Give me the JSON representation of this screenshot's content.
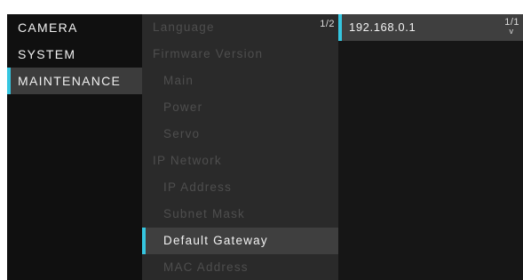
{
  "menu": {
    "categories": [
      {
        "label": "CAMERA"
      },
      {
        "label": "SYSTEM"
      },
      {
        "label": "MAINTENANCE"
      }
    ],
    "selected_category": "MAINTENANCE"
  },
  "submenu": {
    "page_indicator": "1/2",
    "items": [
      {
        "label": "Language"
      },
      {
        "label": "Firmware Version"
      },
      {
        "label": "Main"
      },
      {
        "label": "Power"
      },
      {
        "label": "Servo"
      },
      {
        "label": "IP Network"
      },
      {
        "label": "IP Address"
      },
      {
        "label": "Subnet Mask"
      },
      {
        "label": "Default Gateway"
      },
      {
        "label": "MAC Address"
      }
    ],
    "selected_item": "Default Gateway"
  },
  "value_panel": {
    "page_indicator": "1/1",
    "value": "192.168.0.1",
    "scroll_icon": "chevron-down-icon"
  },
  "colors": {
    "accent": "#35c6e0",
    "selected_row": "#3f3f3f",
    "disabled_text": "#4e4e4e",
    "text": "#f0f0f0"
  }
}
